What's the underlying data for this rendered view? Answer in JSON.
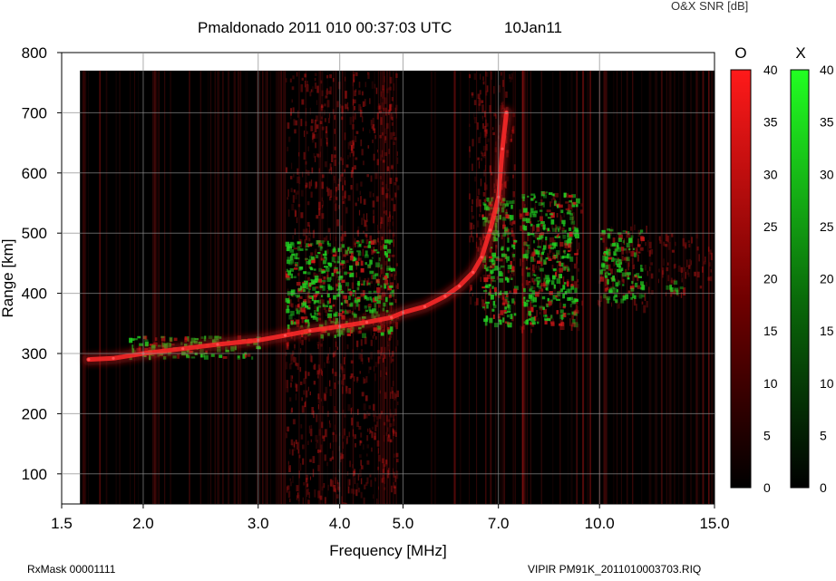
{
  "header": {
    "title": "Pmaldonado 2011 010 00:37:03 UTC",
    "date": "10Jan11",
    "snr_label": "O&X SNR [dB]"
  },
  "footer": {
    "left": "RxMask 00001111",
    "right": "VIPIR  PM91K_2011010003703.RIQ"
  },
  "colors": {
    "o_mode": "#ff2020",
    "x_mode": "#20ff20",
    "background": "#000000"
  },
  "chart_data": {
    "type": "heatmap",
    "xlabel": "Frequency [MHz]",
    "ylabel": "Range [km]",
    "xscale": "log",
    "xlim": [
      1.5,
      15.0
    ],
    "ylim": [
      50,
      800
    ],
    "xticks": [
      1.5,
      2.0,
      3.0,
      4.0,
      5.0,
      7.0,
      10.0,
      15.0
    ],
    "xtick_labels": [
      "1.5",
      "2.0",
      "3.0",
      "4.0",
      "5.0",
      "7.0",
      "10.0",
      "15.0"
    ],
    "yticks": [
      100,
      200,
      300,
      400,
      500,
      600,
      700,
      800
    ],
    "ytick_labels": [
      "100",
      "200",
      "300",
      "400",
      "500",
      "600",
      "700",
      "800"
    ],
    "grid": true,
    "data_region": {
      "freq": [
        1.6,
        15.0
      ],
      "range": [
        50,
        770
      ]
    },
    "colorbars": [
      {
        "name": "O",
        "color": "#ff2020",
        "range": [
          0,
          40
        ],
        "ticks": [
          0,
          5,
          10,
          15,
          20,
          25,
          30,
          35,
          40
        ]
      },
      {
        "name": "X",
        "color": "#20ff20",
        "range": [
          0,
          40
        ],
        "ticks": [
          0,
          5,
          10,
          15,
          20,
          25,
          30,
          35,
          40
        ]
      }
    ],
    "o_trace": [
      [
        1.65,
        290
      ],
      [
        1.8,
        292
      ],
      [
        2.0,
        300
      ],
      [
        2.3,
        308
      ],
      [
        2.6,
        315
      ],
      [
        3.0,
        322
      ],
      [
        3.3,
        330
      ],
      [
        3.6,
        338
      ],
      [
        4.0,
        345
      ],
      [
        4.4,
        352
      ],
      [
        4.8,
        360
      ],
      [
        5.0,
        368
      ],
      [
        5.4,
        378
      ],
      [
        5.8,
        395
      ],
      [
        6.1,
        412
      ],
      [
        6.4,
        435
      ],
      [
        6.6,
        460
      ],
      [
        6.8,
        505
      ],
      [
        7.0,
        560
      ],
      [
        7.1,
        640
      ],
      [
        7.2,
        700
      ]
    ],
    "x_patches": [
      {
        "freq": [
          1.9,
          3.0
        ],
        "range": [
          295,
          330
        ]
      },
      {
        "freq": [
          3.3,
          4.8
        ],
        "range": [
          330,
          490
        ]
      },
      {
        "freq": [
          6.6,
          7.4
        ],
        "range": [
          350,
          560
        ]
      },
      {
        "freq": [
          7.6,
          9.2
        ],
        "range": [
          350,
          570
        ]
      },
      {
        "freq": [
          10.0,
          11.6
        ],
        "range": [
          390,
          510
        ]
      },
      {
        "freq": [
          12.5,
          13.3
        ],
        "range": [
          405,
          425
        ]
      }
    ],
    "o_noise_bands": [
      {
        "freq": [
          3.3,
          4.9
        ],
        "range": [
          50,
          770
        ]
      },
      {
        "freq": [
          6.3,
          7.4
        ],
        "range": [
          380,
          770
        ]
      },
      {
        "freq": [
          7.5,
          9.4
        ],
        "range": [
          340,
          560
        ]
      },
      {
        "freq": [
          9.9,
          12.0
        ],
        "range": [
          380,
          520
        ]
      },
      {
        "freq": [
          12.2,
          14.8
        ],
        "range": [
          400,
          500
        ]
      }
    ]
  }
}
